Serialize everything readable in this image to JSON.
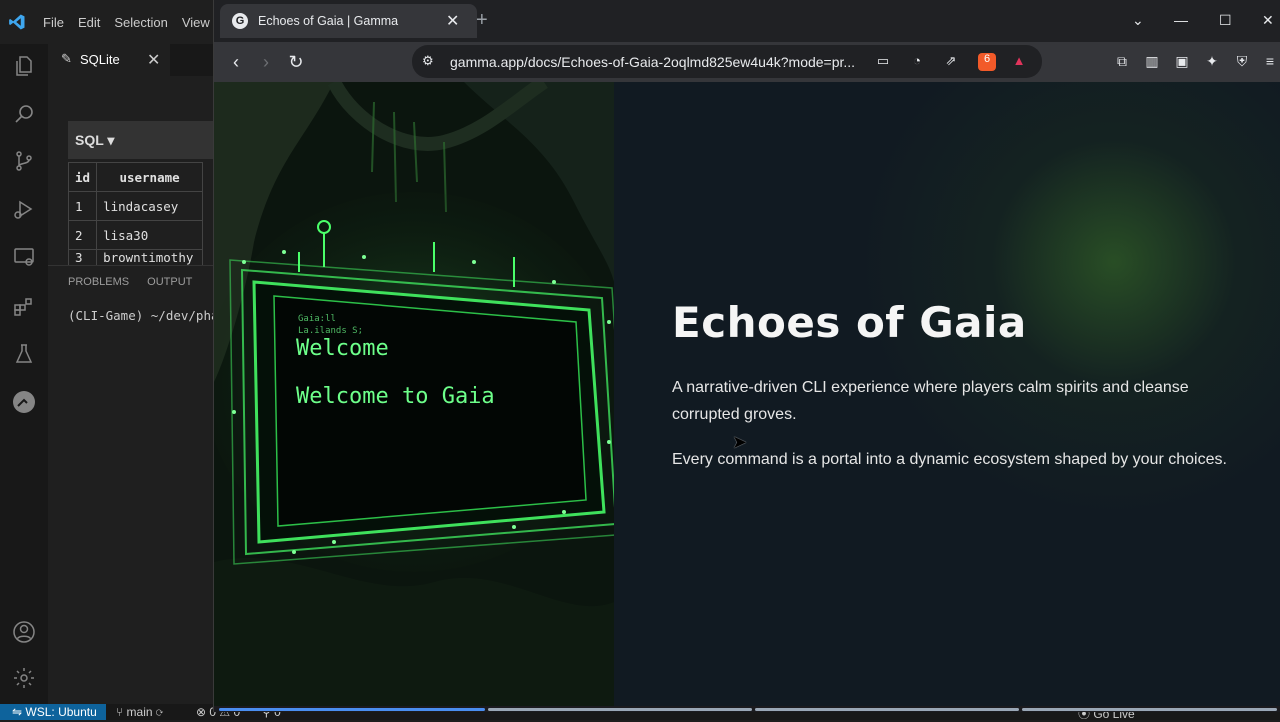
{
  "vscode": {
    "menu": [
      "File",
      "Edit",
      "Selection",
      "View"
    ],
    "tab": {
      "label": "SQLite"
    },
    "sql_header": "SQL ▾",
    "table": {
      "columns": [
        "id",
        "username"
      ],
      "rows": [
        [
          "1",
          "lindacasey"
        ],
        [
          "2",
          "lisa30"
        ],
        [
          "3",
          "browntimothy"
        ]
      ]
    },
    "panel_tabs": [
      "PROBLEMS",
      "OUTPUT"
    ],
    "terminal_line": "(CLI-Game) ~/dev/pha",
    "status": {
      "remote": "WSL: Ubuntu",
      "branch": "main",
      "errors": "0 ⚠ 0",
      "ports": "0",
      "golive": "Go Live"
    }
  },
  "browser": {
    "tab_title": "Echoes of Gaia | Gamma",
    "favicon_letter": "G",
    "url": "gamma.app/docs/Echoes-of-Gaia-2oqlmd825ew4u4k?mode=pr...",
    "brave_badge": "6"
  },
  "page": {
    "title": "Echoes of Gaia",
    "paragraph1": "A narrative-driven CLI experience where players calm spirits and cleanse corrupted groves.",
    "paragraph2": "Every command is a portal into a dynamic ecosystem shaped by your choices.",
    "screen_small_1": "Gaia:ll",
    "screen_small_2": "La.ilands S;",
    "screen_welcome": "Welcome",
    "screen_welcome_gaia": "Welcome to Gaia"
  },
  "colors": {
    "accent_blue": "#0e639c",
    "neon_green": "#6dff8a",
    "progress_active": "#4a8ef0"
  }
}
